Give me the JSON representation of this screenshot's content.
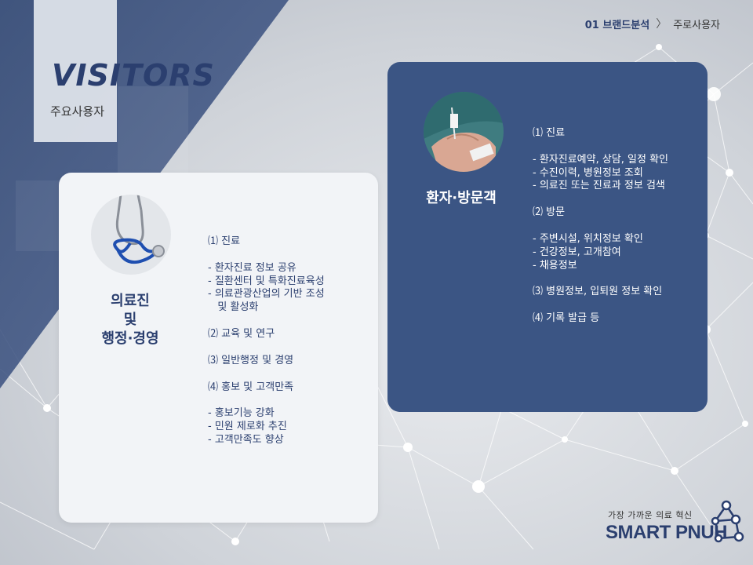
{
  "breadcrumb": {
    "section": "01 브랜드분석",
    "separator": "〉",
    "current": "주로사용자"
  },
  "header": {
    "title": "VISITORS",
    "subtitle": "주요사용자"
  },
  "left_card": {
    "avatar_icon": "stethoscope-icon",
    "role": [
      "의료진",
      "및",
      "행정·경영"
    ],
    "items": [
      "⑴ 진료",
      "",
      "- 환자진료 정보 공유",
      "- 질환센터 및 특화진료육성",
      "- 의료관광산업의 기반 조성",
      "   및 활성화",
      "",
      "⑵ 교육 및 연구",
      "",
      "⑶ 일반행정 및 경영",
      "",
      "⑷ 홍보 및 고객만족",
      "",
      "- 홍보기능 강화",
      "- 민원 제로화 추진",
      "- 고객만족도 향상"
    ]
  },
  "right_card": {
    "avatar_icon": "patient-hand-iv-icon",
    "role": [
      "환자·방문객"
    ],
    "items": [
      "⑴ 진료",
      "",
      "- 환자진료예약, 상담, 일정 확인",
      "- 수진이력, 병원정보 조회",
      "- 의료진 또는 진료과 정보 검색",
      "",
      "⑵ 방문",
      "",
      "- 주변시설, 위치정보 확인",
      "- 건강정보, 고개참여",
      "- 채용정보",
      "",
      "⑶ 병원정보, 입퇴원 정보 확인",
      "",
      "⑷ 기록 발급 등"
    ]
  },
  "logo": {
    "tagline": "가장 가까운 의료 혁신",
    "name": "SMART PNUH"
  },
  "colors": {
    "navy": "#2b3f6f",
    "card_blue": "#3b5584",
    "card_light": "#f2f4f7"
  }
}
